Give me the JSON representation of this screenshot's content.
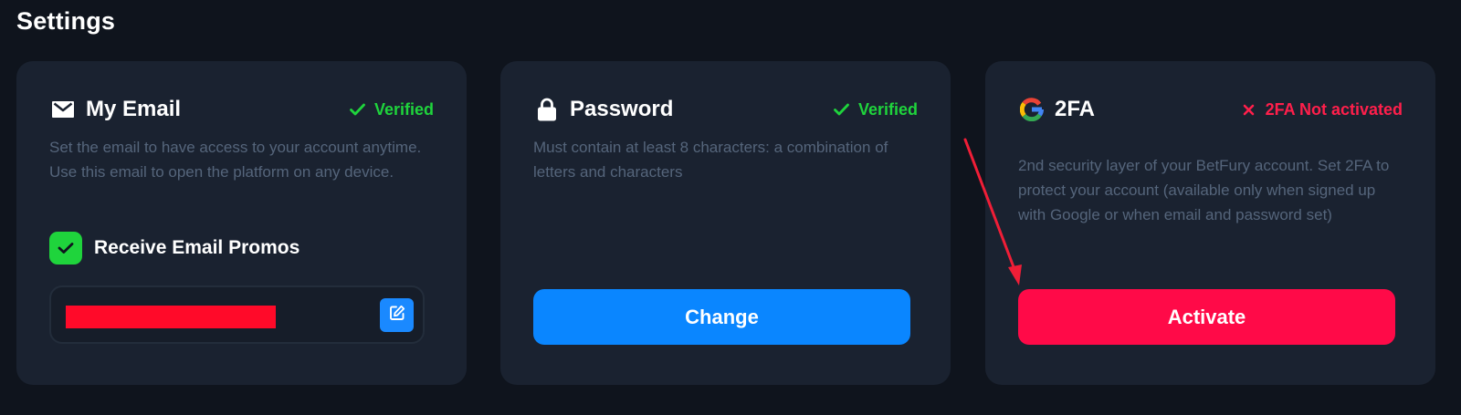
{
  "page": {
    "title": "Settings"
  },
  "colors": {
    "background": "#0f141d",
    "card": "#1a2230",
    "verified": "#1fd43c",
    "not_activated": "#ff1f4b",
    "primary_button": "#0a86ff",
    "danger_button": "#ff0a48",
    "description_text": "#55657b",
    "annotation_arrow": "#f01e37"
  },
  "email_card": {
    "icon": "envelope-icon",
    "title": "My Email",
    "status_icon": "checkmark-icon",
    "status": "Verified",
    "description": "Set the email to have access to your account anytime. Use this email to open the platform on any device.",
    "promo_checkbox": {
      "label": "Receive Email Promos",
      "checked": true
    },
    "email_field": {
      "value_redacted": true,
      "edit_icon": "edit-icon"
    }
  },
  "password_card": {
    "icon": "lock-icon",
    "title": "Password",
    "status_icon": "checkmark-icon",
    "status": "Verified",
    "description": "Must contain at least 8 characters: a combination of letters and characters",
    "button_label": "Change"
  },
  "twofa_card": {
    "icon": "google-icon",
    "title": "2FA",
    "status_icon": "cross-icon",
    "status": "2FA Not activated",
    "description": "2nd security layer of your BetFury account. Set 2FA to protect your account (available only when signed up with Google or when email and password set)",
    "button_label": "Activate"
  }
}
